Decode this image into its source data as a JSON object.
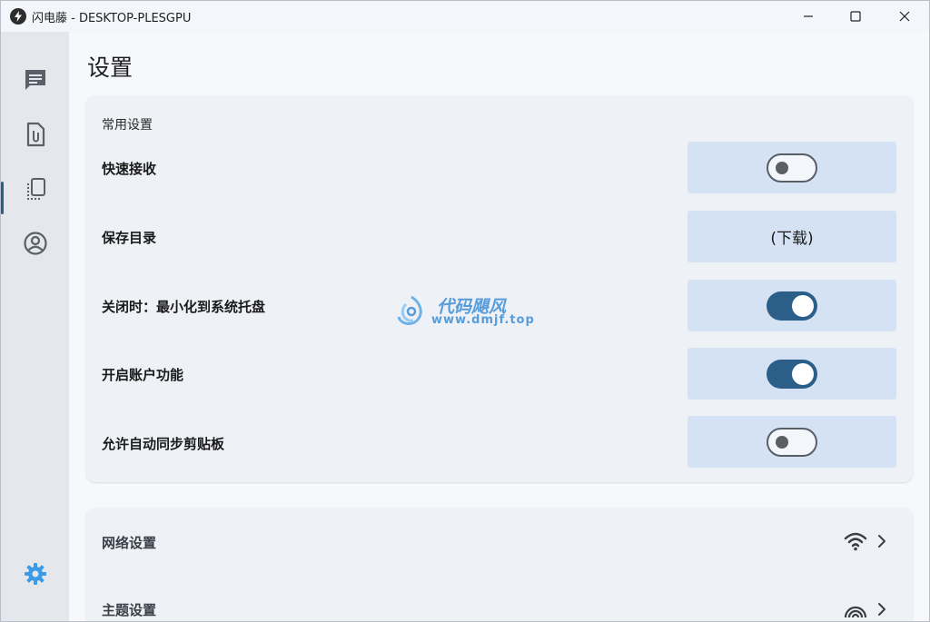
{
  "window": {
    "title": "闪电藤 - DESKTOP-PLESGPU"
  },
  "sidebar": {
    "items": [
      {
        "icon": "message-icon"
      },
      {
        "icon": "file-attachment-icon"
      },
      {
        "icon": "clipboard-history-icon"
      },
      {
        "icon": "account-icon"
      }
    ],
    "settings_icon": "gear-icon",
    "accent": "#2b5f8a",
    "settings_color": "#3b9be8"
  },
  "page": {
    "title": "设置"
  },
  "common_settings": {
    "title": "常用设置",
    "rows": [
      {
        "label": "快速接收",
        "type": "toggle",
        "on": false
      },
      {
        "label": "保存目录",
        "type": "value",
        "value": "(下载)"
      },
      {
        "label": "关闭时：最小化到系统托盘",
        "type": "toggle",
        "on": true
      },
      {
        "label": "开启账户功能",
        "type": "toggle",
        "on": true
      },
      {
        "label": "允许自动同步剪贴板",
        "type": "toggle",
        "on": false
      }
    ]
  },
  "nav_settings": [
    {
      "label": "网络设置",
      "icon": "wifi-icon"
    },
    {
      "label": "主题设置",
      "icon": "theme-icon"
    }
  ],
  "watermark": {
    "title": "代码飓风",
    "url": "www.dmjf.top"
  }
}
